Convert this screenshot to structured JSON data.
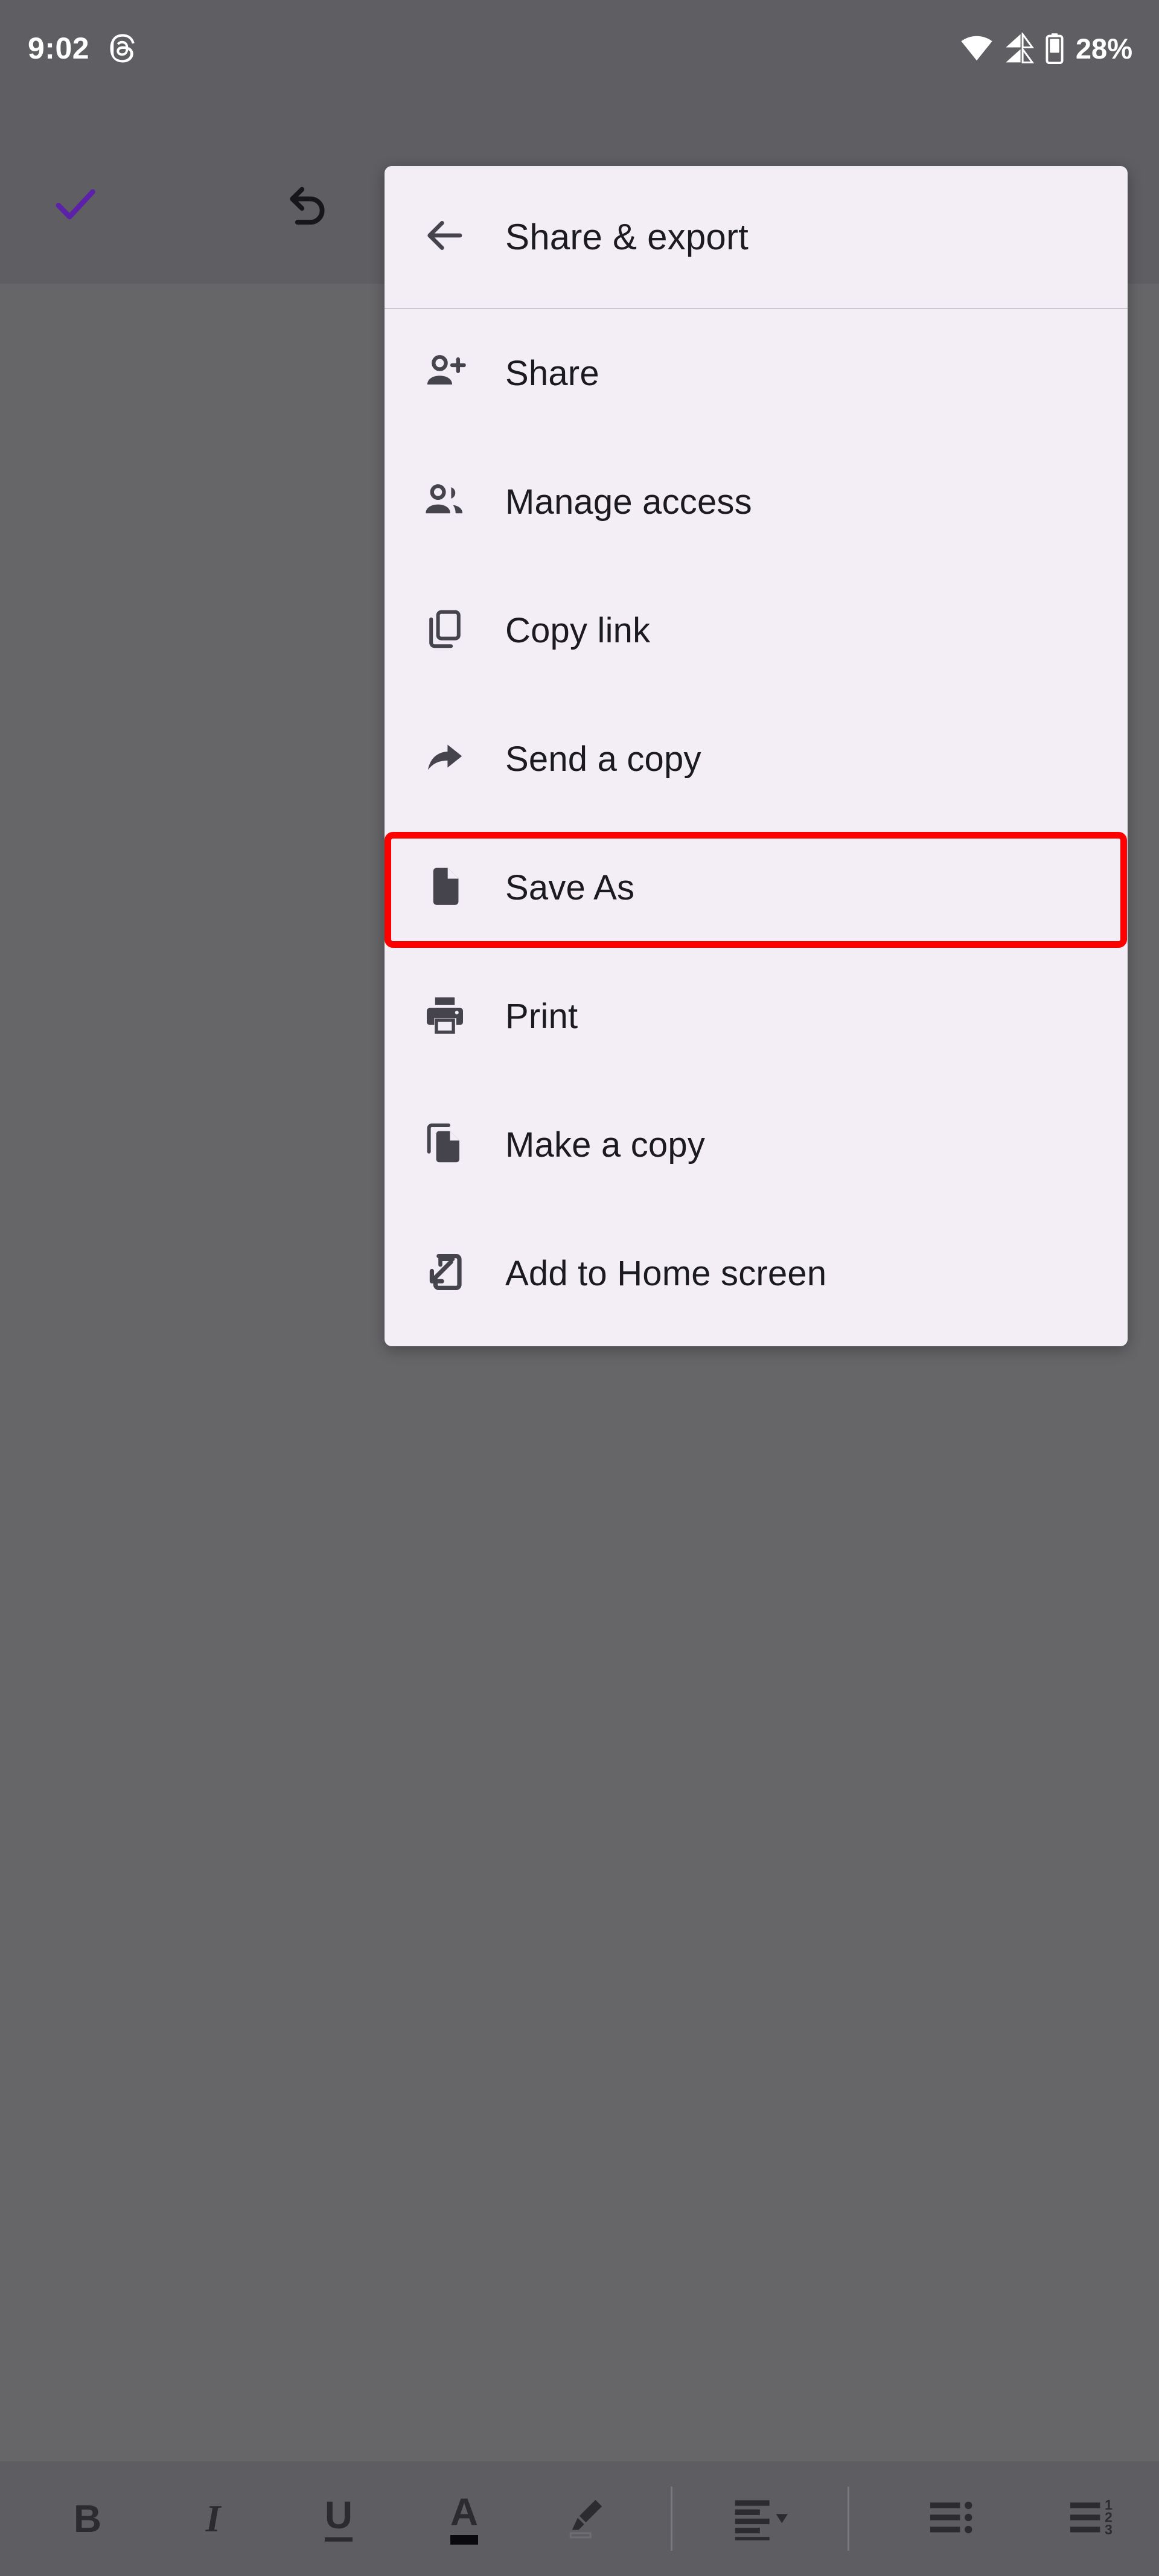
{
  "status_bar": {
    "time": "9:02",
    "app_notification_icon": "threads-icon",
    "wifi_icon": "wifi-icon",
    "cellular_icon": "cellular-signal-icon",
    "battery_icon": "battery-icon",
    "battery_percent": "28%"
  },
  "app_bar": {
    "accept_icon": "checkmark-icon",
    "accept_color": "#5B21A8",
    "undo_icon": "undo-icon",
    "redo_icon": "redo-icon",
    "overflow_icon": "more-vert-icon"
  },
  "menu": {
    "header": {
      "back_icon": "back-arrow-icon",
      "title": "Share & export"
    },
    "background_color": "#F3EDF5",
    "items": [
      {
        "icon": "person-add-icon",
        "label": "Share",
        "highlighted": false
      },
      {
        "icon": "people-icon",
        "label": "Manage access",
        "highlighted": false
      },
      {
        "icon": "copy-link-icon",
        "label": "Copy link",
        "highlighted": false
      },
      {
        "icon": "send-arrow-icon",
        "label": "Send a copy",
        "highlighted": false
      },
      {
        "icon": "document-icon",
        "label": "Save As",
        "highlighted": true
      },
      {
        "icon": "printer-icon",
        "label": "Print",
        "highlighted": false
      },
      {
        "icon": "duplicate-doc-icon",
        "label": "Make a copy",
        "highlighted": false
      },
      {
        "icon": "add-to-home-icon",
        "label": "Add to Home screen",
        "highlighted": false
      }
    ]
  },
  "highlight": {
    "target_label": "Save As",
    "color": "#FF0000"
  },
  "bottom_toolbar": {
    "items": [
      {
        "name": "bold-button",
        "icon": "bold-icon",
        "label": "B"
      },
      {
        "name": "italic-button",
        "icon": "italic-icon",
        "label": "I"
      },
      {
        "name": "underline-button",
        "icon": "underline-icon",
        "label": "U"
      },
      {
        "name": "text-color-button",
        "icon": "text-color-icon",
        "label": "A"
      },
      {
        "name": "highlight-color-button",
        "icon": "marker-pen-icon",
        "label": ""
      },
      {
        "name": "align-button",
        "icon": "text-align-icon",
        "label": ""
      },
      {
        "name": "bulleted-list-button",
        "icon": "bulleted-list-icon",
        "label": ""
      },
      {
        "name": "numbered-list-button",
        "icon": "numbered-list-icon",
        "label": ""
      }
    ]
  },
  "colors": {
    "scrim": "#666568",
    "appbar_scrim": "#5F5E62",
    "menu_surface": "#F3EDF5",
    "menu_text": "#1B1B1F",
    "icon_dark": "#45434B",
    "accent_purple": "#5B21A8",
    "highlight_red": "#FF0000"
  }
}
